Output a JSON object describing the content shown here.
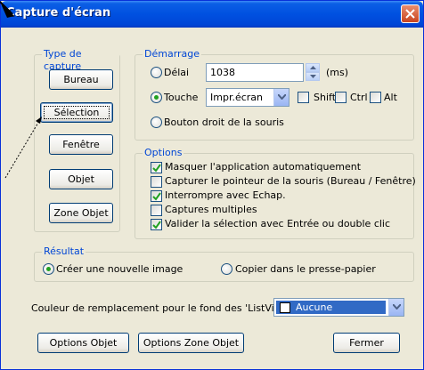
{
  "window": {
    "title": "Capture d'écran"
  },
  "capture_type": {
    "legend": "Type de capture",
    "buttons": [
      "Bureau",
      "Sélection",
      "Fenêtre",
      "Objet",
      "Zone Objet"
    ]
  },
  "startup": {
    "legend": "Démarrage",
    "delay_label": "Délai",
    "delay_value": "1038",
    "delay_unit": "(ms)",
    "key_label": "Touche",
    "key_value": "Impr.écran",
    "shift_label": "Shift",
    "ctrl_label": "Ctrl",
    "alt_label": "Alt",
    "right_button_label": "Bouton droit de la souris"
  },
  "options": {
    "legend": "Options",
    "items": [
      {
        "label": "Masquer l'application automatiquement",
        "checked": true
      },
      {
        "label": "Capturer le pointeur de la souris (Bureau / Fenêtre)",
        "checked": false
      },
      {
        "label": "Interrompre avec Echap.",
        "checked": true
      },
      {
        "label": "Captures multiples",
        "checked": false
      },
      {
        "label": "Valider la sélection avec Entrée ou double clic",
        "checked": true
      }
    ]
  },
  "result": {
    "legend": "Résultat",
    "new_image_label": "Créer une nouvelle image",
    "clipboard_label": "Copier dans le presse-papier"
  },
  "listview": {
    "label": "Couleur de remplacement pour le fond des 'ListView' :",
    "value": "Aucune"
  },
  "footer": {
    "options_objet": "Options Objet",
    "options_zone_objet": "Options Zone Objet",
    "close": "Fermer"
  },
  "colors": {
    "title_blue": "#0050e0",
    "legend_blue": "#0046d5",
    "dialog_bg": "#ece9d8",
    "check_green": "#21a121",
    "selection_blue": "#316ac5"
  }
}
